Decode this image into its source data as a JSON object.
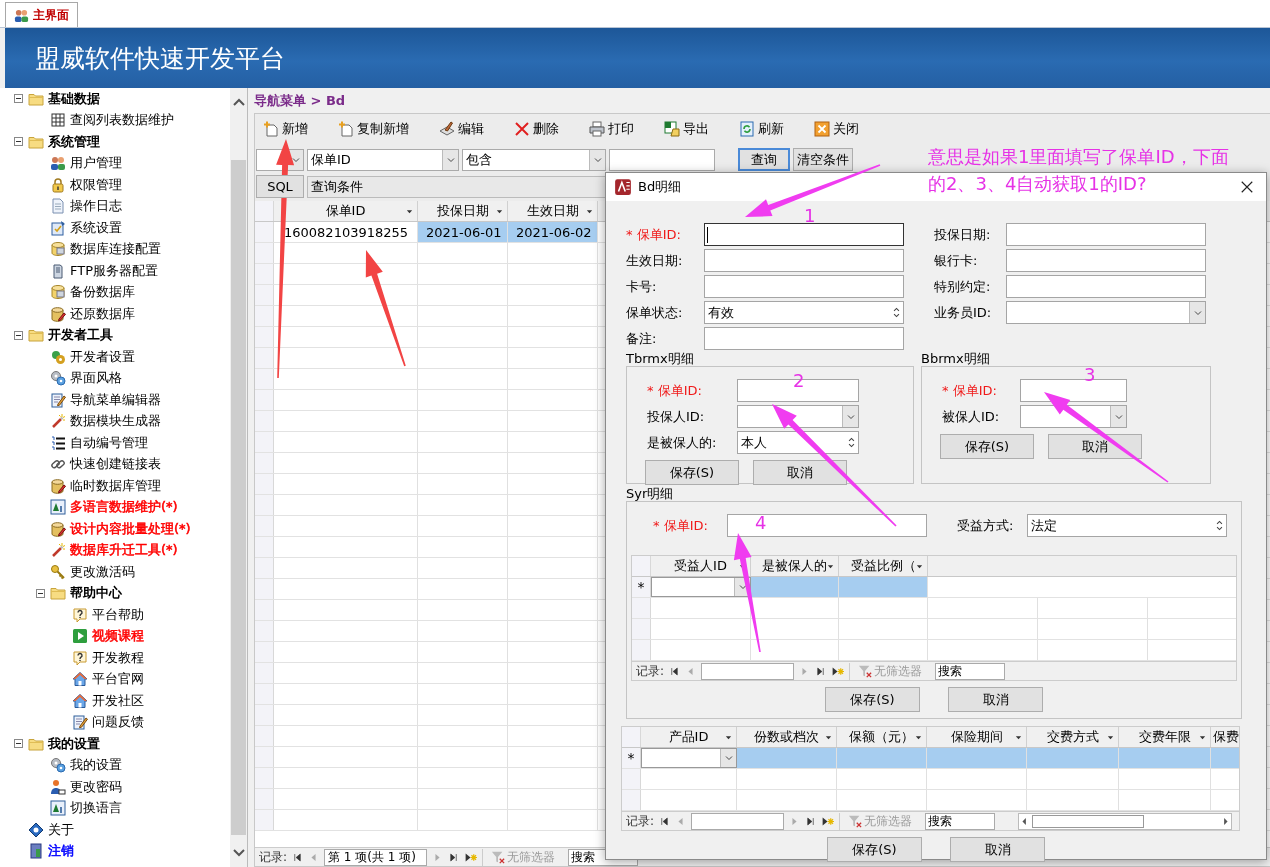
{
  "tab": {
    "label": "主界面",
    "selected": true
  },
  "app_title": "盟威软件快速开发平台",
  "sidebar": {
    "tree": [
      {
        "label": "基础数据",
        "kind": "folder",
        "expanded": true,
        "children": [
          {
            "label": "查阅列表数据维护",
            "kind": "grid"
          }
        ]
      },
      {
        "label": "系统管理",
        "kind": "folder",
        "expanded": true,
        "children": [
          {
            "label": "用户管理",
            "kind": "users"
          },
          {
            "label": "权限管理",
            "kind": "lock"
          },
          {
            "label": "操作日志",
            "kind": "doc"
          },
          {
            "label": "系统设置",
            "kind": "settings"
          },
          {
            "label": "数据库连接配置",
            "kind": "db"
          },
          {
            "label": "FTP服务器配置",
            "kind": "server"
          },
          {
            "label": "备份数据库",
            "kind": "db"
          },
          {
            "label": "还原数据库",
            "kind": "dbedit"
          }
        ]
      },
      {
        "label": "开发者工具",
        "kind": "folder",
        "expanded": true,
        "children": [
          {
            "label": "开发者设置",
            "kind": "devgear"
          },
          {
            "label": "界面风格",
            "kind": "gears"
          },
          {
            "label": "导航菜单编辑器",
            "kind": "editdoc"
          },
          {
            "label": "数据模块生成器",
            "kind": "wand"
          },
          {
            "label": "自动编号管理",
            "kind": "numlist"
          },
          {
            "label": "快速创建链接表",
            "kind": "chain"
          },
          {
            "label": "临时数据库管理",
            "kind": "dbedit"
          },
          {
            "label": "多语言数据维护(*)",
            "kind": "lang",
            "color": "#ff0000"
          },
          {
            "label": "设计内容批量处理(*)",
            "kind": "dbedit",
            "color": "#ff0000"
          },
          {
            "label": "数据库升迁工具(*)",
            "kind": "wand",
            "color": "#ff0000"
          },
          {
            "label": "更改激活码",
            "kind": "key"
          },
          {
            "label": "帮助中心",
            "kind": "folder",
            "expanded": true,
            "children": [
              {
                "label": "平台帮助",
                "kind": "help"
              },
              {
                "label": "视频课程",
                "kind": "play",
                "color": "#ff0000"
              },
              {
                "label": "开发教程",
                "kind": "help"
              },
              {
                "label": "平台官网",
                "kind": "house"
              },
              {
                "label": "开发社区",
                "kind": "house"
              },
              {
                "label": "问题反馈",
                "kind": "editdoc"
              }
            ]
          }
        ]
      },
      {
        "label": "我的设置",
        "kind": "folder",
        "expanded": true,
        "children": [
          {
            "label": "我的设置",
            "kind": "gears"
          },
          {
            "label": "更改密码",
            "kind": "person"
          },
          {
            "label": "切换语言",
            "kind": "lang"
          }
        ]
      },
      {
        "label": "关于",
        "kind": "info"
      },
      {
        "label": "注销",
        "kind": "door",
        "color": "#0000ff"
      }
    ]
  },
  "breadcrumb": "导航菜单 > Bd",
  "toolbar": [
    {
      "label": "新增",
      "kind": "new"
    },
    {
      "label": "复制新增",
      "kind": "new"
    },
    {
      "label": "编辑",
      "kind": "edit"
    },
    {
      "label": "删除",
      "kind": "delete"
    },
    {
      "label": "打印",
      "kind": "print"
    },
    {
      "label": "导出",
      "kind": "export"
    },
    {
      "label": "刷新",
      "kind": "refresh"
    },
    {
      "label": "关闭",
      "kind": "close"
    }
  ],
  "filter": {
    "field": "保单ID",
    "operator": "包含",
    "query_button": "查询",
    "clear_button": "清空条件",
    "sql_button": "SQL",
    "conditions": "查询条件"
  },
  "table": {
    "columns": [
      "保单ID",
      "投保日期",
      "生效日期"
    ],
    "rows": [
      {
        "cells": [
          "160082103918255",
          "2021-06-01",
          "2021-06-02"
        ],
        "selected": true
      }
    ]
  },
  "record_nav": {
    "label": "记录:",
    "position": "第 1 项(共 1 项)",
    "filter": "无筛选器",
    "search": "搜索"
  },
  "dialog": {
    "title": "Bd明细",
    "fields": [
      {
        "label": "* 保单ID:",
        "kind": "text",
        "required": true,
        "focused": true
      },
      {
        "label": "投保日期:",
        "kind": "text",
        "required": false
      },
      {
        "label": "生效日期:",
        "kind": "text",
        "required": false
      },
      {
        "label": "银行卡:",
        "kind": "text",
        "required": false
      },
      {
        "label": "卡号:",
        "kind": "text",
        "required": false
      },
      {
        "label": "特别约定:",
        "kind": "text",
        "required": false
      },
      {
        "label": "保单状态:",
        "kind": "spinner",
        "value": "有效",
        "required": false
      },
      {
        "label": "业务员ID:",
        "kind": "combo",
        "required": false
      },
      {
        "label": "备注:",
        "kind": "text",
        "required": false
      }
    ],
    "subforms": [
      {
        "title": "Tbrmx明细",
        "fields": [
          {
            "label": "* 保单ID:",
            "kind": "text",
            "required": true
          },
          {
            "label": "投保人ID:",
            "kind": "combo",
            "required": false
          },
          {
            "label": "是被保人的:",
            "kind": "spinner",
            "value": "本人",
            "required": false
          }
        ],
        "buttons": [
          "保存(S)",
          "取消"
        ]
      },
      {
        "title": "Bbrmx明细",
        "fields": [
          {
            "label": "* 保单ID:",
            "kind": "text",
            "required": true
          },
          {
            "label": "被保人ID:",
            "kind": "combo",
            "required": false
          }
        ],
        "buttons": [
          "保存(S)",
          "取消"
        ]
      }
    ],
    "syr": {
      "title": "Syr明细",
      "fields": [
        {
          "label": "* 保单ID:",
          "kind": "text",
          "required": true
        },
        {
          "label": "受益方式:",
          "kind": "spinner",
          "value": "法定",
          "required": false
        }
      ],
      "columns": [
        "受益人ID",
        "是被保人的",
        "受益比例（"
      ],
      "new_row": {
        "marker": "*",
        "selected": true
      },
      "nav": {
        "label": "记录:",
        "filter": "无筛选器",
        "search": "搜索"
      },
      "buttons": [
        "保存(S)",
        "取消"
      ]
    },
    "products": {
      "columns": [
        "产品ID",
        "份数或档次",
        "保额（元）",
        "保险期间",
        "交费方式",
        "交费年限",
        "保费"
      ],
      "new_row": {
        "marker": "*",
        "selected": true
      },
      "nav": {
        "label": "记录:",
        "filter": "无筛选器",
        "search": "搜索"
      }
    },
    "buttons": [
      "保存(S)",
      "取消"
    ]
  },
  "annotation": {
    "note": "意思是如果1里面填写了保单ID，下面的2、3、4自动获取1的ID?",
    "markers": [
      "1",
      "2",
      "3",
      "4"
    ]
  }
}
